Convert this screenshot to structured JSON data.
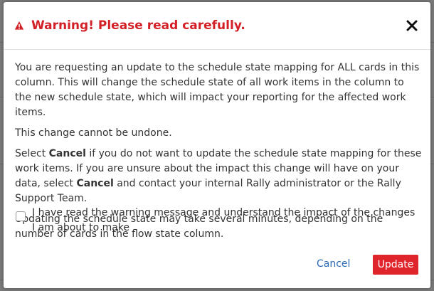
{
  "dialog": {
    "title": "Warning! Please read carefully.",
    "close_icon": "close-icon",
    "warning_icon": "warning-triangle-icon",
    "paragraphs": {
      "p1": "You are requesting an update to the schedule state mapping for ALL cards in this column. This will change the schedule state of all work items in the column to the new schedule state, which will impact your reporting for the affected work items.",
      "p2": "This change cannot be undone.",
      "p3_a": "Select ",
      "p3_cancel1": "Cancel",
      "p3_b": " if you do not want to update the schedule state mapping for these work items. If you are unsure about the impact this change will have on your data, select ",
      "p3_cancel2": "Cancel",
      "p3_c": " and contact your internal Rally administrator or the Rally Support Team.",
      "p4": "Updating the schedule state may take several minutes, depending on the number of cards in the flow state column."
    },
    "acknowledge": {
      "label": "I have read the warning message and understand the impact of the changes I am about to make",
      "checked": false
    },
    "buttons": {
      "cancel": "Cancel",
      "update": "Update"
    }
  },
  "colors": {
    "warning_red": "#d32027",
    "primary_button": "#e0242b",
    "link_blue": "#2b6bb5",
    "text": "#333333"
  }
}
